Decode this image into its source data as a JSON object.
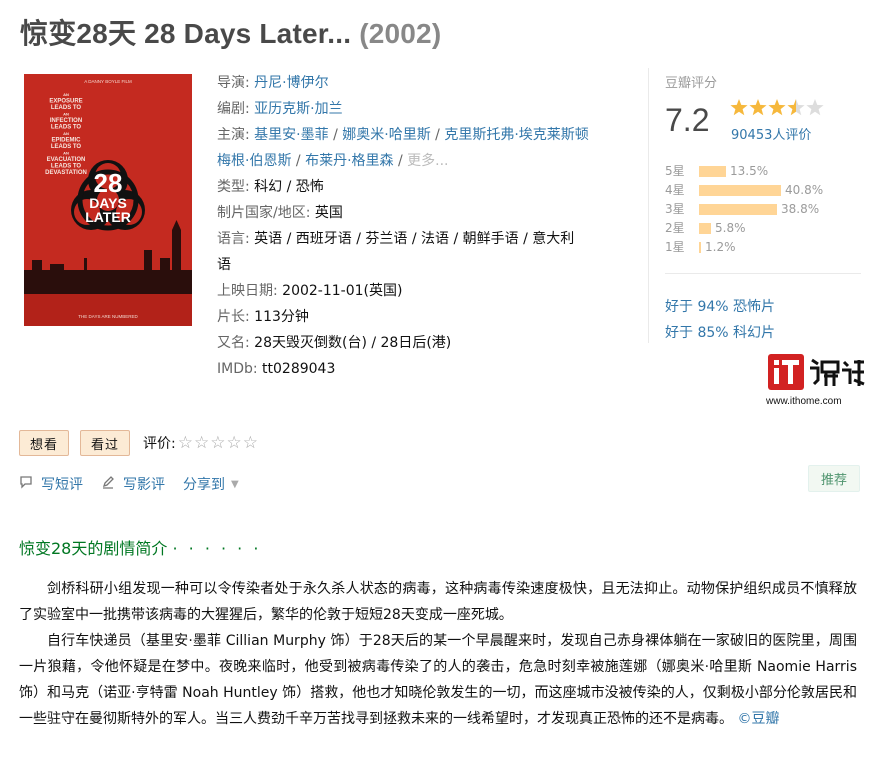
{
  "title": {
    "main": "惊变28天 28 Days Later...",
    "year": "(2002)"
  },
  "poster": {
    "top_text": "A DANNY BOYLE FILM",
    "tagline_lines": [
      "AN",
      "EXPOSURE",
      "LEADS TO",
      "AN",
      "INFECTION",
      "LEADS TO",
      "AN",
      "EPIDEMIC",
      "LEADS TO",
      "AN",
      "EVACUATION",
      "LEADS TO",
      "DEVASTATION"
    ],
    "logo_lines": [
      "28",
      "DAYS",
      "LATER"
    ],
    "bottom_text": "THE DAYS ARE NUMBERED"
  },
  "info": {
    "director_label": "导演:",
    "director": "丹尼·博伊尔",
    "writer_label": "编剧:",
    "writer": "亚历克斯·加兰",
    "cast_label": "主演:",
    "cast": [
      "基里安·墨菲",
      "娜奥米·哈里斯",
      "克里斯托弗·埃克莱斯顿",
      "梅根·伯恩斯",
      "布莱丹·格里森"
    ],
    "cast_more": "更多...",
    "genre_label": "类型:",
    "genre": "科幻 / 恐怖",
    "country_label": "制片国家/地区:",
    "country": "英国",
    "language_label": "语言:",
    "language_line1": "英语 / 西班牙语 / 芬兰语 / 法语 / 朝鲜手语 / 意大利",
    "language_line2": "语",
    "release_label": "上映日期:",
    "release": "2002-11-01(英国)",
    "runtime_label": "片长:",
    "runtime": "113分钟",
    "aka_label": "又名:",
    "aka": "28天毁灭倒数(台) / 28日后(港)",
    "imdb_label": "IMDb:",
    "imdb": "tt0289043"
  },
  "rating": {
    "label": "豆瓣评分",
    "score": "7.2",
    "stars_value": 3.5,
    "votes": "90453人评价",
    "bars": [
      {
        "label": "5星",
        "pct": "13.5%",
        "value": 13.5
      },
      {
        "label": "4星",
        "pct": "40.8%",
        "value": 40.8
      },
      {
        "label": "3星",
        "pct": "38.8%",
        "value": 38.8
      },
      {
        "label": "2星",
        "pct": "5.8%",
        "value": 5.8
      },
      {
        "label": "1星",
        "pct": "1.2%",
        "value": 1.2
      }
    ],
    "better_than": [
      "好于 94% 恐怖片",
      "好于 85% 科幻片"
    ]
  },
  "watermark": {
    "url": "www.ithome.com"
  },
  "actions": {
    "want": "想看",
    "seen": "看过",
    "rate_label": "评价:",
    "empty_stars": "☆☆☆☆☆"
  },
  "links": {
    "short_review": "写短评",
    "review": "写影评",
    "share": "分享到"
  },
  "recommend": "推荐",
  "summary": {
    "heading": "惊变28天的剧情简介",
    "dots": "· · · · · ·",
    "p1": "剑桥科研小组发现一种可以令传染者处于永久杀人状态的病毒，这种病毒传染速度极快，且无法抑止。动物保护组织成员不慎释放了实验室中一批携带该病毒的大猩猩后，繁华的伦敦于短短28天变成一座死城。",
    "p2": "自行车快递员（基里安·墨菲 Cillian Murphy 饰）于28天后的某一个早晨醒来时，发现自己赤身裸体躺在一家破旧的医院里，周围一片狼藉，令他怀疑是在梦中。夜晚来临时，他受到被病毒传染了的人的袭击，危急时刻幸被施莲娜（娜奥米·哈里斯 Naomie Harris 饰）和马克（诺亚·亨特雷 Noah Huntley 饰）搭救，他也才知晓伦敦发生的一切，而这座城市没被传染的人，仅剩极小部分伦敦居民和一些驻守在曼彻斯特外的军人。当三人费劲千辛万苦找寻到拯救未来的一线希望时，才发现真正恐怖的还不是病毒。",
    "copyright": "©豆瓣"
  }
}
